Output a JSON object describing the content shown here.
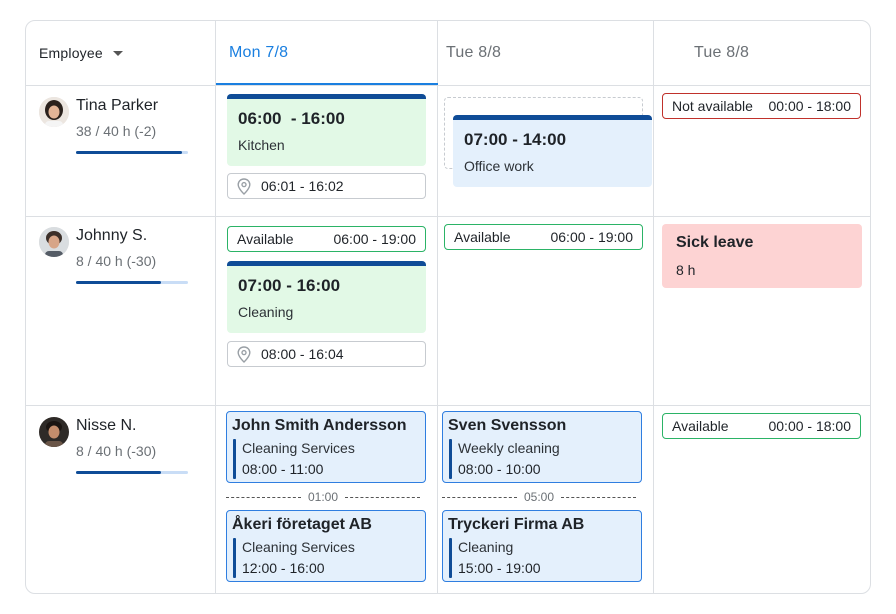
{
  "header": {
    "employee_label": "Employee",
    "days": [
      {
        "label": "Mon  7/8",
        "active": true
      },
      {
        "label": "Tue  8/8",
        "active": false
      },
      {
        "label": "Tue  8/8",
        "active": false
      }
    ]
  },
  "employees": [
    {
      "name": "Tina Parker",
      "hours": "38 / 40 h (-2)",
      "progress": 0.95
    },
    {
      "name": "Johnny S.",
      "hours": "8 / 40 h (-30)",
      "progress": 0.76
    },
    {
      "name": "Nisse N.",
      "hours": "8 / 40 h (-30)",
      "progress": 0.76
    }
  ],
  "row1": {
    "mon_shift": {
      "time": "06:00  - 16:00",
      "label": "Kitchen"
    },
    "mon_clock": "06:01 - 16:02",
    "tue_shift": {
      "time": "07:00 - 14:00",
      "label": "Office work"
    },
    "tue2_notavail": {
      "label": "Not available",
      "time": "00:00 - 18:00"
    }
  },
  "row2": {
    "mon_avail": {
      "label": "Available",
      "time": "06:00 - 19:00"
    },
    "mon_shift": {
      "time": "07:00 - 16:00",
      "label": "Cleaning"
    },
    "mon_clock": "08:00 - 16:04",
    "tue_avail": {
      "label": "Available",
      "time": "06:00 - 19:00"
    },
    "tue2_sick": {
      "title": "Sick leave",
      "hours": "8 h"
    }
  },
  "row3": {
    "mon_job1": {
      "client": "John Smith Andersson",
      "service": "Cleaning Services",
      "time": "08:00 - 11:00"
    },
    "mon_gap": "01:00",
    "mon_job2": {
      "client": "Åkeri företaget AB",
      "service": "Cleaning Services",
      "time": "12:00 - 16:00"
    },
    "tue_job1": {
      "client": "Sven Svensson",
      "service": "Weekly cleaning",
      "time": "08:00 - 10:00"
    },
    "tue_gap": "05:00",
    "tue_job2": {
      "client": "Tryckeri Firma AB",
      "service": "Cleaning",
      "time": "15:00 - 19:00"
    },
    "tue2_avail": {
      "label": "Available",
      "time": "00:00 - 18:00"
    }
  },
  "colors": {
    "accent": "#1a7fe0",
    "shift_bar": "#0f4c97",
    "shift_green_bg": "#e2f9e6",
    "shift_blue_bg": "#e4f0fc",
    "available_border": "#2bb366",
    "not_available_border": "#c0312b",
    "sick_bg": "#fdd3d3"
  }
}
